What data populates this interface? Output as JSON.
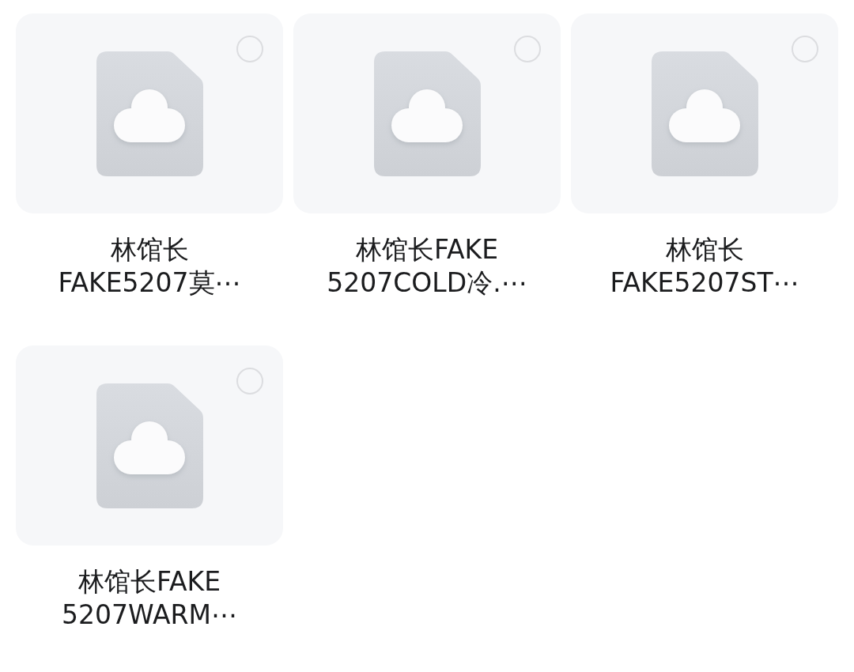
{
  "files": [
    {
      "name": "林馆长\nFAKE5207莫⋯",
      "selected": false
    },
    {
      "name": "林馆长FAKE\n5207COLD冷.⋯",
      "selected": false
    },
    {
      "name": "林馆长\nFAKE5207ST⋯",
      "selected": false
    },
    {
      "name": "林馆长FAKE\n5207WARM⋯",
      "selected": false
    }
  ]
}
